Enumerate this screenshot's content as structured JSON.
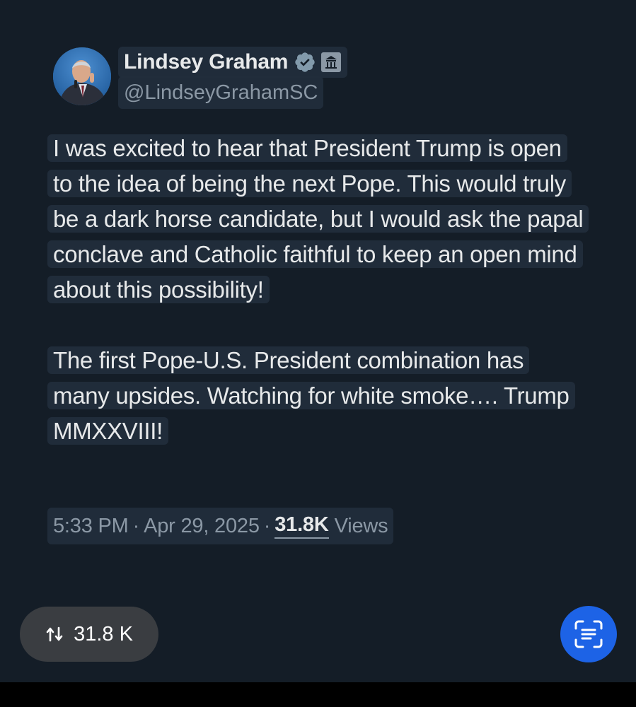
{
  "author": {
    "name": "Lindsey Graham",
    "handle": "@LindseyGrahamSC",
    "avatar_icon": "profile-photo",
    "verified_icon": "verified-badge-icon",
    "affiliation_icon": "government-building-icon"
  },
  "tweet": {
    "paragraphs": [
      "I was excited to hear that President Trump is open to the idea of being the next Pope. This would truly be a dark horse candidate, but I would ask the papal conclave and Catholic faithful to keep an open mind about this possibility!",
      "The first Pope-U.S. President combination has many upsides. Watching for white smoke…. Trump MMXXVIII!"
    ]
  },
  "meta": {
    "time": "5:33 PM",
    "separator": "·",
    "date": "Apr 29, 2025",
    "views_count": "31.8K",
    "views_label": "Views"
  },
  "overlay": {
    "repost_count": "31.8 K",
    "repost_icon": "repost-arrows-icon",
    "scan_icon": "text-scan-icon"
  },
  "colors": {
    "background": "#141d27",
    "text_primary": "#e7e9ea",
    "text_secondary": "#8b98a5",
    "scan_button": "#1d63e6",
    "pill": "#3a3d41"
  }
}
